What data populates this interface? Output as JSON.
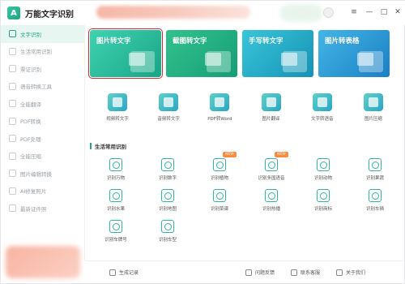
{
  "app": {
    "title": "万能文字识别",
    "logo_glyph": "A"
  },
  "window_controls": {
    "menu": "≡",
    "minimize": "—",
    "maximize": "□",
    "close": "✕"
  },
  "sidebar": {
    "items": [
      {
        "label": "文字识别",
        "active": true
      },
      {
        "label": "生活常用识别"
      },
      {
        "label": "票证识别"
      },
      {
        "label": "语音转换工具"
      },
      {
        "label": "全能翻译"
      },
      {
        "label": "PDF转换"
      },
      {
        "label": "PDF处理"
      },
      {
        "label": "全能压缩"
      },
      {
        "label": "图片编辑转换"
      },
      {
        "label": "AI修复照片"
      },
      {
        "label": "最新证件照"
      }
    ]
  },
  "cards": [
    {
      "label": "图片转文字"
    },
    {
      "label": "截图转文字"
    },
    {
      "label": "手写转文字"
    },
    {
      "label": "图片转表格"
    }
  ],
  "tools": [
    {
      "label": "视频转文字"
    },
    {
      "label": "音频转文字"
    },
    {
      "label": "PDF转Word"
    },
    {
      "label": "图片翻译"
    },
    {
      "label": "文字转语音"
    },
    {
      "label": "图片压缩"
    }
  ],
  "section": {
    "title": "生活常用识别"
  },
  "life_items": [
    {
      "label": "识别万物"
    },
    {
      "label": "识别数字"
    },
    {
      "label": "识别植物",
      "badge": "NEW"
    },
    {
      "label": "识别多国语音",
      "badge": "NEW"
    },
    {
      "label": "识别动物"
    },
    {
      "label": "识别果蔬"
    },
    {
      "label": "识别水果"
    },
    {
      "label": "识别地图"
    },
    {
      "label": "识别菜谱"
    },
    {
      "label": "识别热播"
    },
    {
      "label": "识别商标"
    },
    {
      "label": "识别车辆"
    },
    {
      "label": "识别车牌号"
    },
    {
      "label": "识别车型"
    }
  ],
  "bottom": {
    "history": "生成记录",
    "feedback": "问题反馈",
    "contact": "联系客服",
    "about": "关于我们"
  },
  "colors": {
    "accent": "#20a884",
    "highlight_outline": "#d92b2b",
    "badge": "#ff8a3d"
  }
}
